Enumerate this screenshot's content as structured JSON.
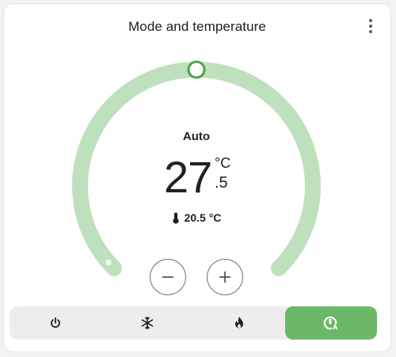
{
  "card": {
    "title": "Mode and temperature"
  },
  "thermostat": {
    "mode_label": "Auto",
    "target_integer": "27",
    "target_decimal": ".5",
    "unit": "°C",
    "current_temperature": "20.5 °C",
    "setpoint_fraction": 0.5,
    "current_fraction": 0.0
  },
  "modes": [
    {
      "name": "off",
      "icon": "power-icon",
      "active": false
    },
    {
      "name": "cool",
      "icon": "snowflake-icon",
      "active": false
    },
    {
      "name": "heat",
      "icon": "flame-icon",
      "active": false
    },
    {
      "name": "auto",
      "icon": "thermostat-auto-icon",
      "active": true
    }
  ],
  "colors": {
    "arc": "#bfe0bd",
    "accent": "#6cb869",
    "handle": "#4ca34a"
  }
}
